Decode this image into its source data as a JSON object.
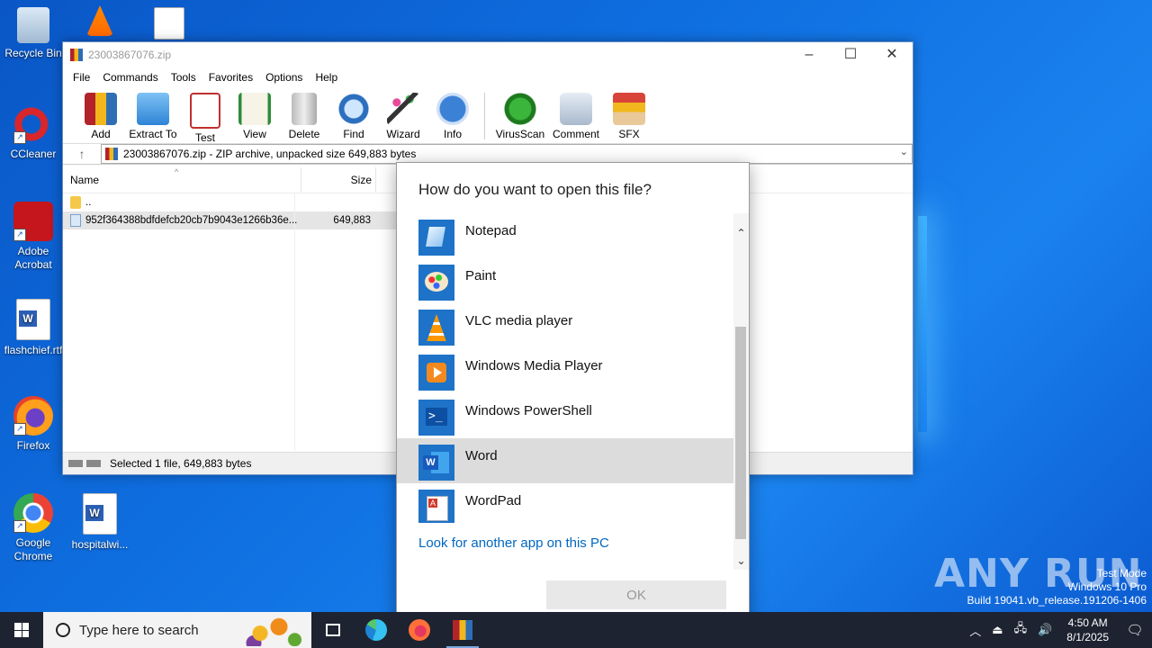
{
  "desktop": {
    "icons": [
      {
        "label": "Recycle Bin"
      },
      {
        "label": "CCleaner"
      },
      {
        "label": "Adobe Acrobat"
      },
      {
        "label": "flashchief.rtf"
      },
      {
        "label": "Firefox"
      },
      {
        "label": "Google Chrome"
      },
      {
        "label": "hospitalwi..."
      }
    ]
  },
  "winrar": {
    "title": "23003867076.zip",
    "menu": [
      "File",
      "Commands",
      "Tools",
      "Favorites",
      "Options",
      "Help"
    ],
    "toolbar": [
      "Add",
      "Extract To",
      "Test",
      "View",
      "Delete",
      "Find",
      "Wizard",
      "Info",
      "VirusScan",
      "Comment",
      "SFX"
    ],
    "address": "23003867076.zip - ZIP archive, unpacked size 649,883 bytes",
    "columns": {
      "name": "Name",
      "size": "Size"
    },
    "rows": [
      {
        "name": "..",
        "size": ""
      },
      {
        "name": "952f364388bdfdefcb20cb7b9043e1266b36e...",
        "size": "649,883"
      }
    ],
    "status": "Selected 1 file, 649,883 bytes"
  },
  "dialog": {
    "title": "How do you want to open this file?",
    "apps": [
      {
        "name": "Notepad"
      },
      {
        "name": "Paint"
      },
      {
        "name": "VLC media player"
      },
      {
        "name": "Windows Media Player"
      },
      {
        "name": "Windows PowerShell"
      },
      {
        "name": "Word"
      },
      {
        "name": "WordPad"
      }
    ],
    "look_more": "Look for another app on this PC",
    "ok": "OK"
  },
  "taskbar": {
    "search_placeholder": "Type here to search",
    "time": "4:50 AM",
    "date": "8/1/2025"
  },
  "watermark": {
    "line1": "Test Mode",
    "line2": "Windows 10 Pro",
    "line3": "Build 19041.vb_release.191206-1406",
    "brand": "ANY RUN"
  },
  "colors": {
    "accent": "#0067c0",
    "desktop": "#0f6fe0",
    "taskbar": "#1d2330"
  }
}
